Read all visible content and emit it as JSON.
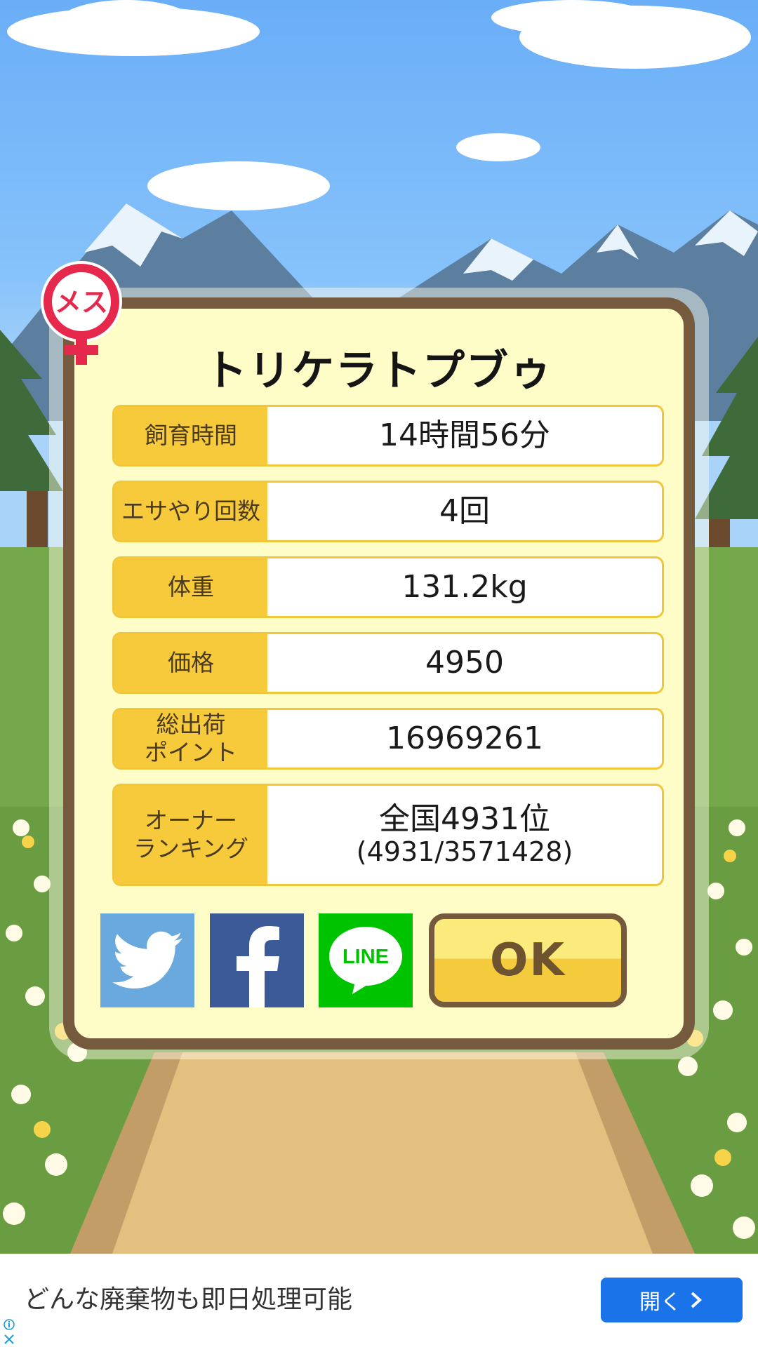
{
  "animal": {
    "name": "トリケラトプブゥ",
    "gender_badge": "メス"
  },
  "stats": [
    {
      "label": "飼育時間",
      "value": "14時間56分"
    },
    {
      "label": "エサやり回数",
      "value": "4回"
    },
    {
      "label": "体重",
      "value": "131.2kg"
    },
    {
      "label": "価格",
      "value": "4950"
    },
    {
      "label_line1": "総出荷",
      "label_line2": "ポイント",
      "value": "16969261"
    },
    {
      "label_line1": "オーナー",
      "label_line2": "ランキング",
      "value": "全国4931位",
      "value_sub": "(4931/3571428)"
    }
  ],
  "buttons": {
    "ok": "OK",
    "line": "LINE"
  },
  "colors": {
    "frame": "#765a3d",
    "panel": "#fefdc8",
    "label_bg": "#f7ca3c",
    "twitter": "#6aa9de",
    "facebook": "#3c5a98",
    "line": "#00c300"
  },
  "icons": [
    "venus-icon",
    "twitter-icon",
    "facebook-icon",
    "line-icon",
    "chevron-right-icon",
    "info-icon",
    "close-icon"
  ],
  "ad": {
    "text": "どんな廃棄物も即日処理可能",
    "button_label": "開く"
  }
}
